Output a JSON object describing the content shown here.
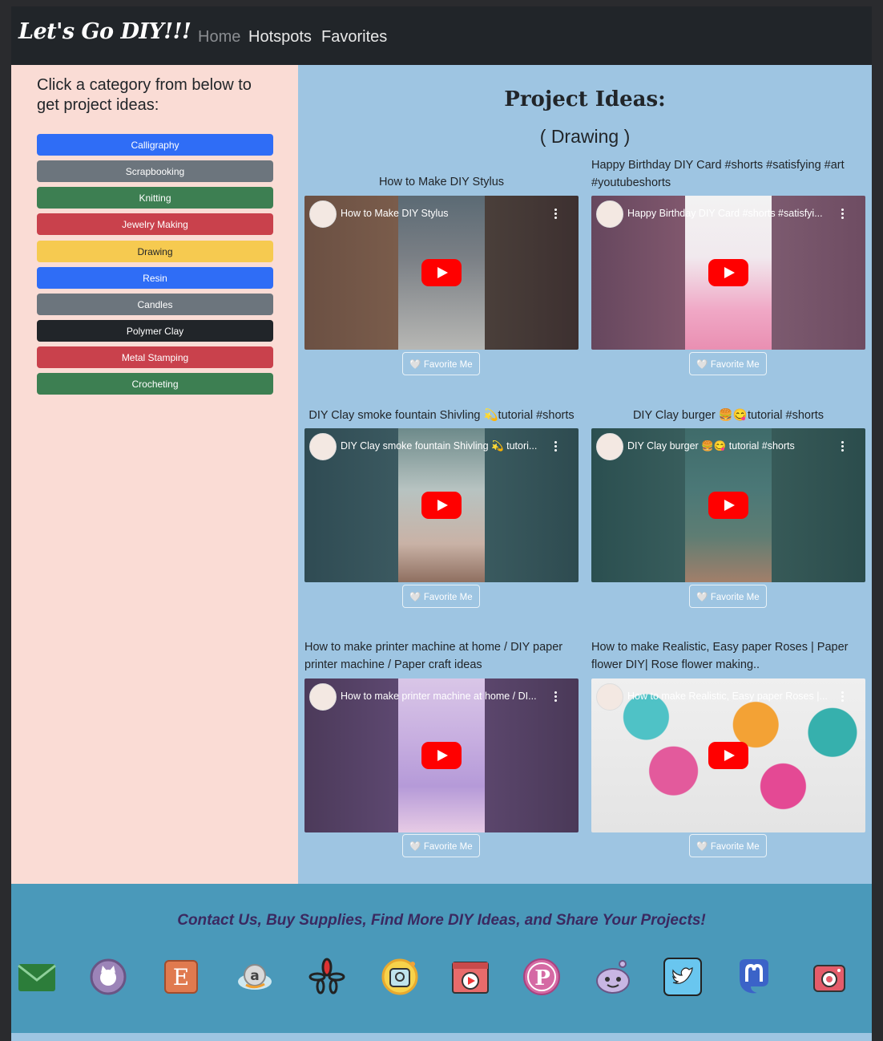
{
  "nav": {
    "brand": "Let's Go DIY!!!",
    "links": [
      "Home",
      "Hotspots",
      "Favorites"
    ]
  },
  "sidebar": {
    "title": "Click a category from below to get project ideas:",
    "categories": [
      {
        "label": "Calligraphy",
        "color": "#2f6df6"
      },
      {
        "label": "Scrapbooking",
        "color": "#6c757d"
      },
      {
        "label": "Knitting",
        "color": "#3d7f52"
      },
      {
        "label": "Jewelry Making",
        "color": "#c9414c"
      },
      {
        "label": "Drawing",
        "color": "#f6ca50"
      },
      {
        "label": "Resin",
        "color": "#2f6df6"
      },
      {
        "label": "Candles",
        "color": "#6c757d"
      },
      {
        "label": "Polymer Clay",
        "color": "#212529"
      },
      {
        "label": "Metal Stamping",
        "color": "#c9414c"
      },
      {
        "label": "Crocheting",
        "color": "#3d7f52"
      }
    ]
  },
  "main": {
    "title": "Project Ideas:",
    "subtitle": "( Drawing )",
    "videos": [
      {
        "title": "How to Make DIY Stylus",
        "video_title": "How to Make DIY Stylus",
        "favorite_label": "🤍 Favorite Me"
      },
      {
        "title": "Happy Birthday DIY Card #shorts #satisfying #art #youtubeshorts",
        "video_title": "Happy Birthday DIY Card #shorts #satisfyi...",
        "favorite_label": "🤍 Favorite Me"
      },
      {
        "title": "DIY Clay smoke fountain Shivling 💫tutorial #shorts",
        "video_title": "DIY Clay smoke fountain Shivling 💫 tutori...",
        "favorite_label": "🤍 Favorite Me"
      },
      {
        "title": "DIY Clay burger 🍔😋tutorial #shorts",
        "video_title": "DIY Clay burger 🍔😋 tutorial #shorts",
        "favorite_label": "🤍 Favorite Me"
      },
      {
        "title": "How to make printer machine at home / DIY paper printer machine / Paper craft ideas",
        "video_title": "How to make printer machine at home / DI...",
        "favorite_label": "🤍 Favorite Me"
      },
      {
        "title": "How to make Realistic, Easy paper Roses | Paper flower DIY| Rose flower making..",
        "video_title": "How to make Realistic, Easy paper Roses |...",
        "favorite_label": "🤍 Favorite Me"
      }
    ]
  },
  "footer": {
    "text": "Contact Us, Buy Supplies, Find More DIY Ideas, and Share Your Projects!",
    "icons": [
      "email-icon",
      "github-icon",
      "etsy-icon",
      "amazon-icon",
      "yelp-icon",
      "pinterest-alt-icon",
      "youtube-icon",
      "pinterest-icon",
      "reddit-icon",
      "twitter-icon",
      "mastodon-icon",
      "instagram-icon"
    ]
  }
}
